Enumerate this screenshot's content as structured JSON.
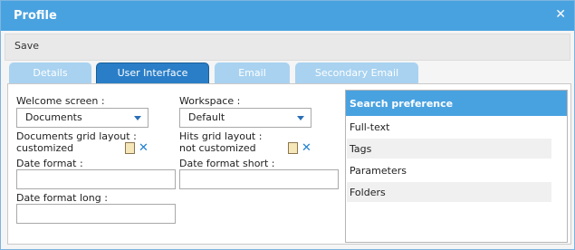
{
  "dialog": {
    "title": "Profile",
    "close_glyph": "✕"
  },
  "toolbar": {
    "save_label": "Save"
  },
  "tabs": [
    {
      "label": "Details"
    },
    {
      "label": "User Interface",
      "active": true
    },
    {
      "label": "Email"
    },
    {
      "label": "Secondary Email"
    }
  ],
  "form": {
    "welcome_screen": {
      "label": "Welcome screen :",
      "value": "Documents"
    },
    "workspace": {
      "label": "Workspace :",
      "value": "Default"
    },
    "documents_grid": {
      "label": "Documents grid layout :",
      "status": "customized"
    },
    "hits_grid": {
      "label": "Hits grid layout :",
      "status": "not customized"
    },
    "date_format": {
      "label": "Date format :",
      "value": ""
    },
    "date_format_short": {
      "label": "Date format short :",
      "value": ""
    },
    "date_format_long": {
      "label": "Date format long :",
      "value": ""
    }
  },
  "search_preference": {
    "title": "Search preference",
    "items": [
      "Full-text",
      "Tags",
      "Parameters",
      "Folders"
    ]
  },
  "icons": {
    "doc": "document-icon",
    "delete": "delete-x-icon",
    "dropdown": "dropdown-arrow-icon"
  },
  "colors": {
    "header_blue": "#49a2e0",
    "active_tab": "#2a7ec7",
    "inactive_tab": "#a8d2f0",
    "delete_x": "#1f7fd1"
  }
}
